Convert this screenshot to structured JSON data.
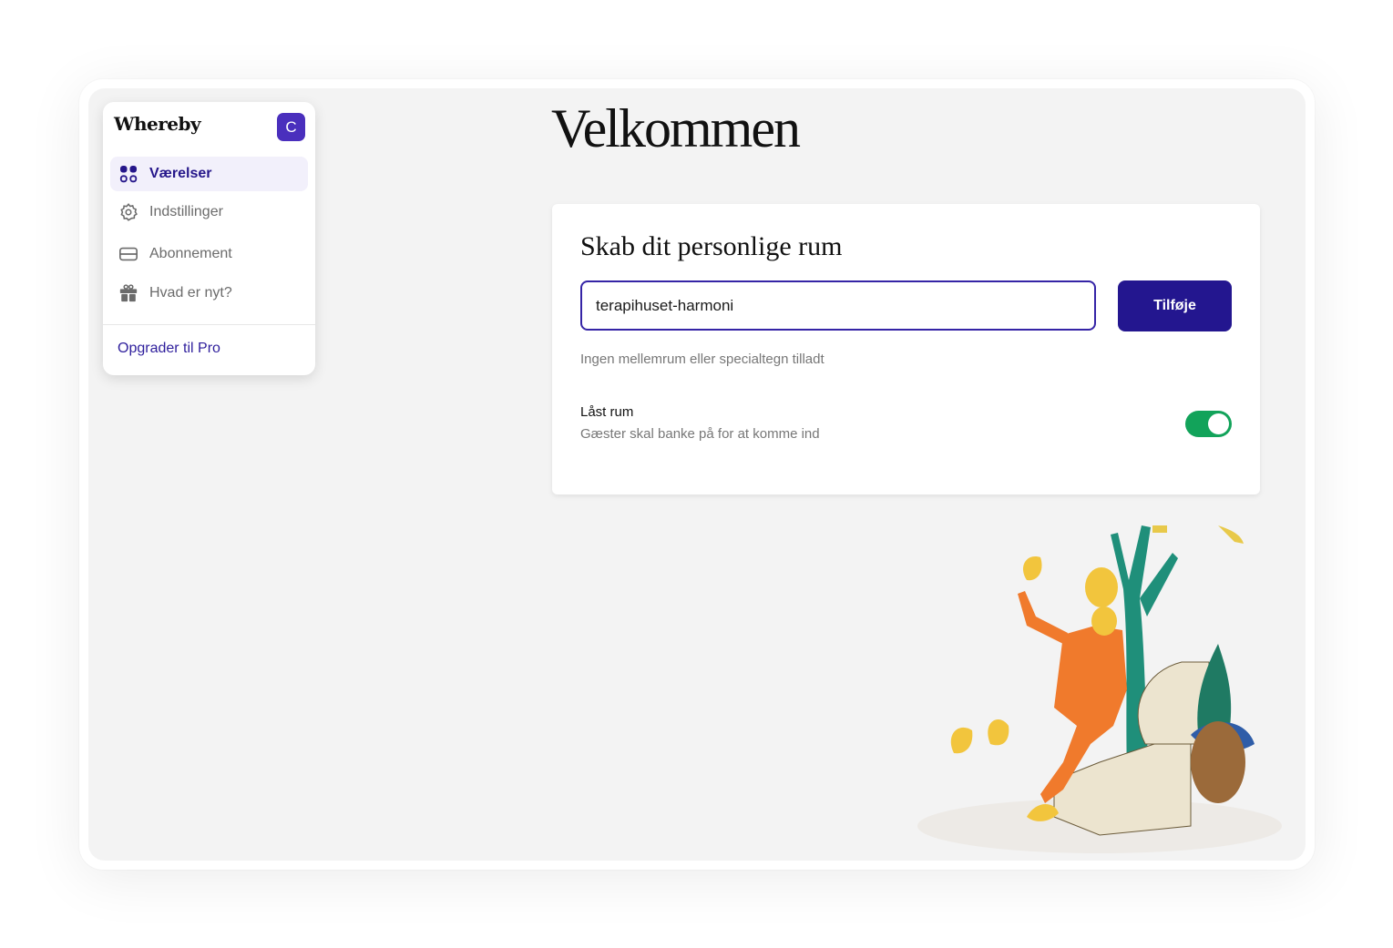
{
  "app": {
    "brand": "Whereby",
    "avatar_letter": "C"
  },
  "sidebar": {
    "items": [
      {
        "label": "Værelser",
        "icon": "grid-icon",
        "active": true
      },
      {
        "label": "Indstillinger",
        "icon": "gear-icon",
        "active": false
      },
      {
        "label": "Abonnement",
        "icon": "credit-card-icon",
        "active": false
      },
      {
        "label": "Hvad er nyt?",
        "icon": "gift-icon",
        "active": false
      }
    ],
    "upgrade_label": "Opgrader til Pro"
  },
  "main": {
    "title": "Velkommen",
    "card": {
      "title": "Skab dit personlige rum",
      "input_value": "terapihuset-harmoni",
      "add_button": "Tilføje",
      "hint": "Ingen mellemrum eller specialtegn tilladt",
      "locked_room_title": "Låst rum",
      "locked_room_desc": "Gæster skal banke på for at komme ind",
      "locked_room_enabled": true
    }
  },
  "colors": {
    "accent": "#23168f",
    "avatar": "#4a2fbd",
    "toggle_on": "#12a35a",
    "background": "#f3f3f3"
  }
}
